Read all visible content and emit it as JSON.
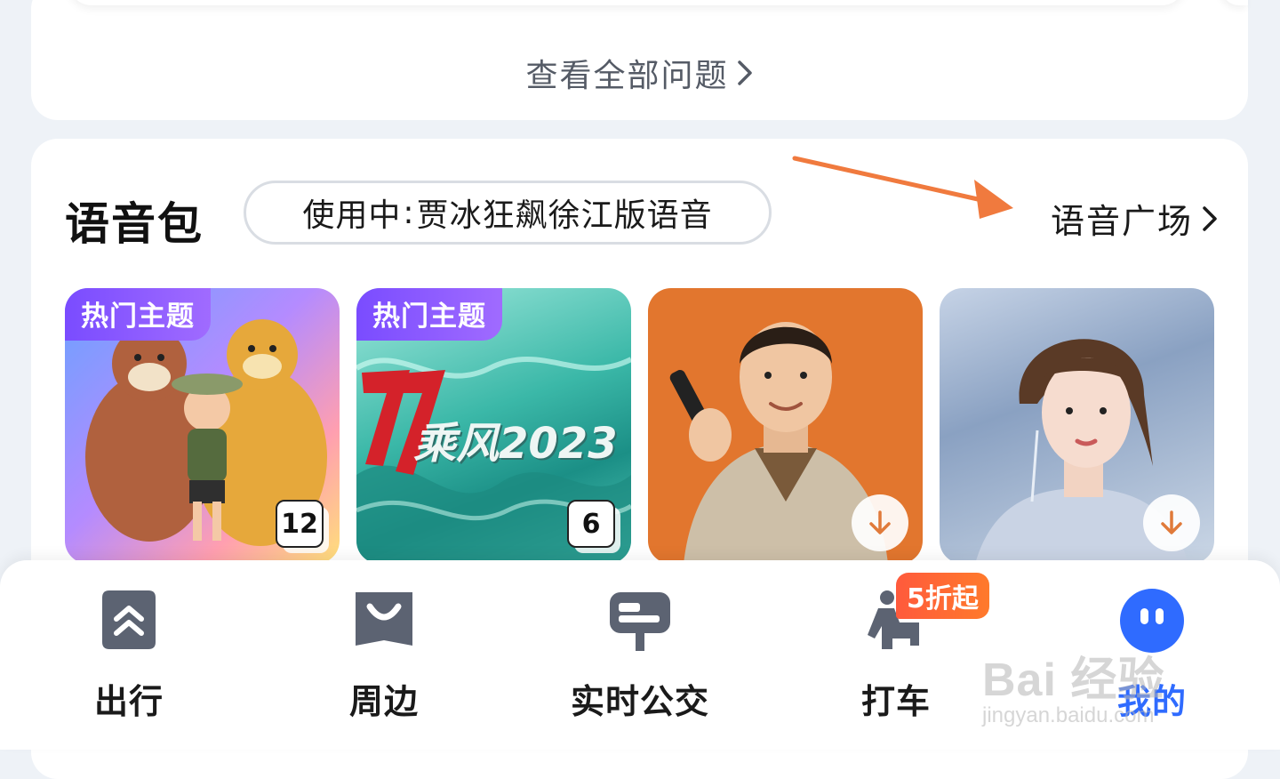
{
  "questions": {
    "view_all_label": "查看全部问题"
  },
  "voice_pack": {
    "title": "语音包",
    "in_use_prefix": "使用中",
    "in_use_name": "贾冰狂飙徐江版语音",
    "plaza_label": "语音广场",
    "tiles": [
      {
        "badge": "热门主题",
        "count": "12",
        "art_text": ""
      },
      {
        "badge": "热门主题",
        "count": "6",
        "art_text": "乘风2023"
      },
      {
        "badge": "",
        "count": "",
        "art_text": ""
      },
      {
        "badge": "",
        "count": "",
        "art_text": ""
      }
    ]
  },
  "bottom_nav": {
    "items": [
      {
        "label": "出行",
        "icon": "travel-icon"
      },
      {
        "label": "周边",
        "icon": "nearby-bag-icon"
      },
      {
        "label": "实时公交",
        "icon": "bus-stop-icon"
      },
      {
        "label": "打车",
        "icon": "taxi-icon"
      },
      {
        "label": "我的",
        "icon": "profile-avatar-icon"
      }
    ],
    "promo_badge": "5折起",
    "active_color": "#2f6bff"
  },
  "annotation": {
    "arrow_color": "#f07a3e"
  },
  "watermark": {
    "line1": "Bai 经验",
    "line2": "jingyan.baidu.com"
  }
}
